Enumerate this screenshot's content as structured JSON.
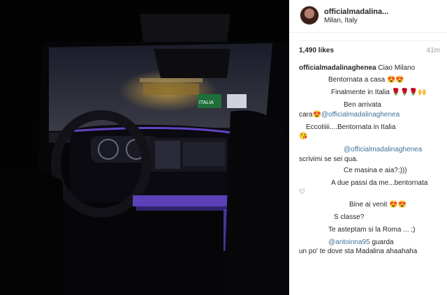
{
  "post": {
    "username": "officialmadalina...",
    "location": "Milan, Italy",
    "likes": "1,490 likes",
    "time": "41m"
  },
  "photo": {
    "road_sign_text": "ITALIA",
    "sign_color": "#1f6e3a",
    "ambient_color": "#6b4bd6"
  },
  "comments": [
    {
      "user": "officialmadalinaghenea",
      "text": "Ciao Milano"
    },
    {
      "text": "Bentornata a casa 😍😍"
    },
    {
      "text": "Finalmente in Italia 🌹🌹🌹🙌"
    },
    {
      "text": "Ben arrivata"
    },
    {
      "text": "cara😍",
      "mention": "@officialmadalinaghenea"
    },
    {
      "text": "Eccotiiii....Bentornata in Italia"
    },
    {
      "text": "😘"
    },
    {
      "mention": "@officialmadalinaghenea"
    },
    {
      "text": "scrivimi se sei qua."
    },
    {
      "text": "Ce masina e aia?:)))"
    },
    {
      "text": "A due passi da me...bentornata"
    },
    {
      "text": "♡"
    },
    {
      "text": "Bine ai venit 😍😍"
    },
    {
      "text": "S classe?"
    },
    {
      "text": "Te asteptam si la Roma ... ;)"
    },
    {
      "mention": "@antoinna95",
      "text": "guarda"
    },
    {
      "text": "un po' te dove sta Madalina ahaahaha"
    }
  ]
}
